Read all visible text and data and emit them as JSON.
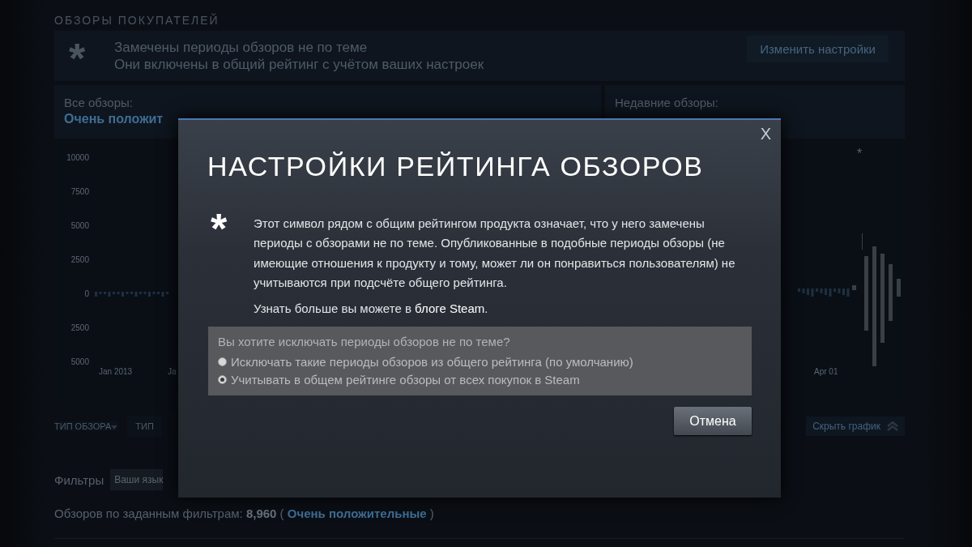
{
  "section_title": "ОБЗОРЫ ПОКУПАТЕЛЕЙ",
  "notice": {
    "symbol": "*",
    "line_1": "Замечены периоды обзоров не по теме",
    "line_2": "Они включены в общий рейтинг с учётом ваших настроек",
    "button": "Изменить настройки"
  },
  "summary": {
    "all_label": "Все обзоры:",
    "all_rating": "Очень положит",
    "recent_label": "Недавние обзоры:"
  },
  "chart": {
    "y_labels": [
      "10000",
      "7500",
      "5000",
      "2500",
      "0",
      "2500",
      "5000"
    ],
    "x_labels": [
      "Jan 2013",
      "Ja",
      "Apr 01"
    ],
    "marker": "*"
  },
  "controls": {
    "review_type": "ТИП ОБЗОРА",
    "column_2": "ТИП",
    "hide_chart": "Скрыть график"
  },
  "filters": {
    "label": "Фильтры",
    "chip": "Ваши язык"
  },
  "filtered": {
    "label": "Обзоров по заданным фильтрам:",
    "count": "8,960",
    "open": "(",
    "rating": "Очень положительные",
    "close": ")"
  },
  "dialog": {
    "title": "НАСТРОЙКИ РЕЙТИНГА ОБЗОРОВ",
    "close": "X",
    "symbol": "*",
    "text": "Этот символ рядом с общим рейтингом продукта означает, что у него замечены периоды с обзорами не по теме. Опубликованные в подобные периоды обзоры (не имеющие отношения к продукту и тому, может ли он понравиться пользователям) не учитываются при подсчёте общего рейтинга.",
    "learn_more": "Узнать больше вы можете в",
    "link": "блоге Steam",
    "end": ".",
    "question": "Вы хотите исключать периоды обзоров не по теме?",
    "options": [
      {
        "label": "Исключать такие периоды обзоров из общего рейтинга (по умолчанию)",
        "selected": false
      },
      {
        "label": "Учитывать в общем рейтинге обзоры от всех покупок в Steam",
        "selected": true
      }
    ],
    "cancel": "Отмена"
  }
}
